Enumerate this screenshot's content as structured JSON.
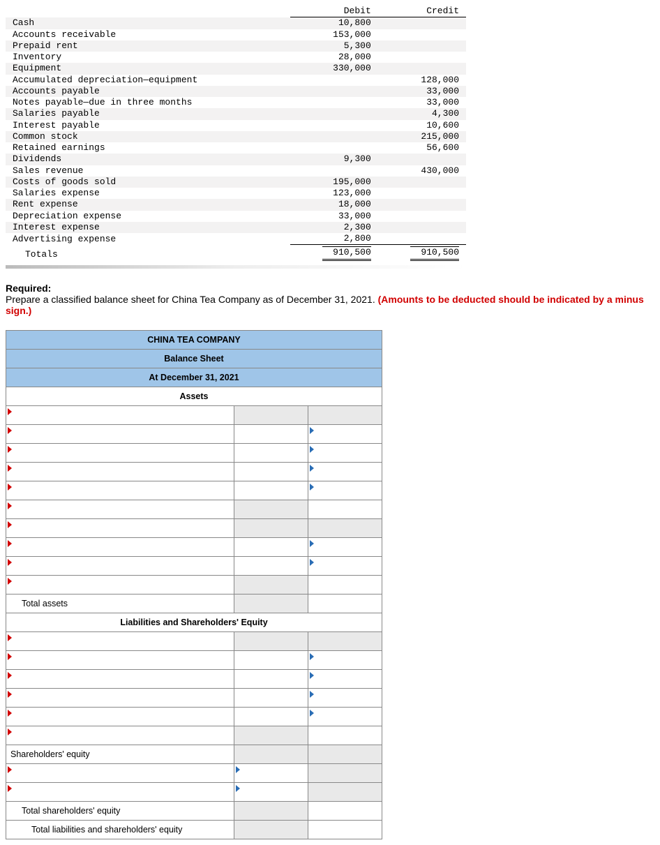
{
  "trial_balance": {
    "header_debit": "Debit",
    "header_credit": "Credit",
    "rows": [
      {
        "acct": "Cash",
        "debit": "10,800",
        "credit": ""
      },
      {
        "acct": "Accounts receivable",
        "debit": "153,000",
        "credit": ""
      },
      {
        "acct": "Prepaid rent",
        "debit": "5,300",
        "credit": ""
      },
      {
        "acct": "Inventory",
        "debit": "28,000",
        "credit": ""
      },
      {
        "acct": "Equipment",
        "debit": "330,000",
        "credit": ""
      },
      {
        "acct": "Accumulated depreciation—equipment",
        "debit": "",
        "credit": "128,000"
      },
      {
        "acct": "Accounts payable",
        "debit": "",
        "credit": "33,000"
      },
      {
        "acct": "Notes payable—due in three months",
        "debit": "",
        "credit": "33,000"
      },
      {
        "acct": "Salaries payable",
        "debit": "",
        "credit": "4,300"
      },
      {
        "acct": "Interest payable",
        "debit": "",
        "credit": "10,600"
      },
      {
        "acct": "Common stock",
        "debit": "",
        "credit": "215,000"
      },
      {
        "acct": "Retained earnings",
        "debit": "",
        "credit": "56,600"
      },
      {
        "acct": "Dividends",
        "debit": "9,300",
        "credit": ""
      },
      {
        "acct": "Sales revenue",
        "debit": "",
        "credit": "430,000"
      },
      {
        "acct": "Costs of goods sold",
        "debit": "195,000",
        "credit": ""
      },
      {
        "acct": "Salaries expense",
        "debit": "123,000",
        "credit": ""
      },
      {
        "acct": "Rent expense",
        "debit": "18,000",
        "credit": ""
      },
      {
        "acct": "Depreciation expense",
        "debit": "33,000",
        "credit": ""
      },
      {
        "acct": "Interest expense",
        "debit": "2,300",
        "credit": ""
      },
      {
        "acct": "Advertising expense",
        "debit": "2,800",
        "credit": ""
      }
    ],
    "totals_label": "Totals",
    "totals_debit": "910,500",
    "totals_credit": "910,500"
  },
  "required": {
    "label": "Required:",
    "text_before": "Prepare a classified balance sheet for China Tea Company as of December 31, 2021. ",
    "red_text": "(Amounts to be deducted should be indicated by a minus sign.)"
  },
  "balance_sheet": {
    "company": "CHINA TEA COMPANY",
    "title": "Balance Sheet",
    "date": "At December 31, 2021",
    "assets_hdr": "Assets",
    "total_assets": "Total assets",
    "liab_hdr": "Liabilities and Shareholders' Equity",
    "sh_equity": "Shareholders' equity",
    "total_sh_equity": "Total shareholders' equity",
    "total_liab_eq": "Total liabilities and shareholders' equity"
  }
}
